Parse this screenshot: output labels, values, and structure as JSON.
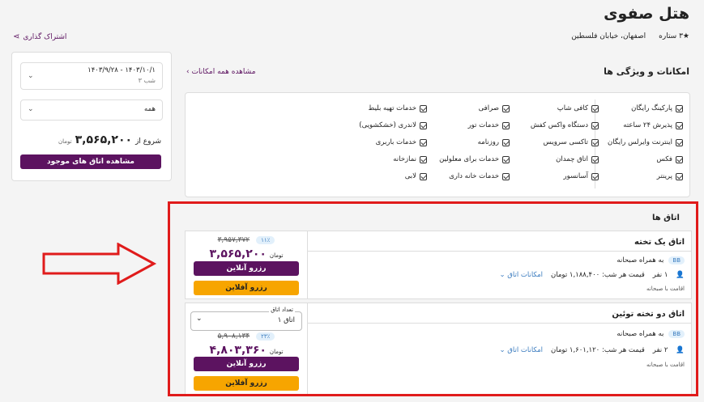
{
  "hotel": {
    "name": "هتل صفوی",
    "stars": "★۳ ستاره",
    "address": "اصفهان، خیابان فلسطین",
    "share": "اشتراک گذاری"
  },
  "sidebar": {
    "dates": "۱۴۰۳/۹/۲۸  -  ۱۴۰۳/۱۰/۱",
    "nights": "۳ شب",
    "filter": "همه",
    "from_label": "شروع از",
    "from_price": "۳,۵۶۵,۲۰۰",
    "currency": "تومان",
    "view_rooms": "مشاهده اتاق های موجود"
  },
  "amenities": {
    "title": "امکانات و ویژگی ها",
    "view_all": "مشاهده همه امکانات",
    "columns": [
      [
        "پارکینگ رایگان",
        "پذیرش ۲۴ ساعته",
        "اینترنت وایرلس رایگان",
        "فکس",
        "پرینتر"
      ],
      [
        "کافی شاپ",
        "دستگاه واکس کفش",
        "تاکسی سرویس",
        "اتاق چمدان",
        "آسانسور"
      ],
      [
        "صرافی",
        "خدمات تور",
        "روزنامه",
        "خدمات برای معلولین",
        "خدمات خانه داری"
      ],
      [
        "خدمات تهیه بلیط",
        "لاندری (خشکشویی)",
        "خدمات باربری",
        "نمازخانه",
        "لابی"
      ]
    ]
  },
  "rooms": {
    "title": "اتاق ها",
    "list": [
      {
        "name": "اتاق یک تخته",
        "badge": "BB",
        "meal": "به همراه صبحانه",
        "persons": "۱ نفر",
        "nightly": "قیمت هر شب: ۱,۱۸۸,۴۰۰ تومان",
        "features": "امکانات اتاق",
        "note": "اقامت با صبحانه",
        "discount": "۱۱٪",
        "old_price": "۳,۹۵۷,۳۷۲",
        "price": "۳,۵۶۵,۲۰۰",
        "currency": "تومان",
        "book_online": "رزرو آنلاین",
        "book_offline": "رزرو آفلاین"
      },
      {
        "name": "اتاق دو تخته توئین",
        "badge": "BB",
        "meal": "به همراه صبحانه",
        "persons": "۲ نفر",
        "nightly": "قیمت هر شب: ۱,۶۰۱,۱۲۰ تومان",
        "features": "امکانات اتاق",
        "note": "اقامت با صبحانه",
        "count_label": "تعداد اتاق",
        "count_value": "۱ اتاق",
        "discount": "۲۳٪",
        "old_price": "۵,۹۰۸,۱۳۴",
        "price": "۴,۸۰۳,۳۶۰",
        "currency": "تومان",
        "book_online": "رزرو آنلاین",
        "book_offline": "رزرو آفلاین"
      }
    ]
  },
  "colors": {
    "brand": "#5c1360",
    "accent": "#f7a500",
    "highlight": "#e01b1b"
  }
}
